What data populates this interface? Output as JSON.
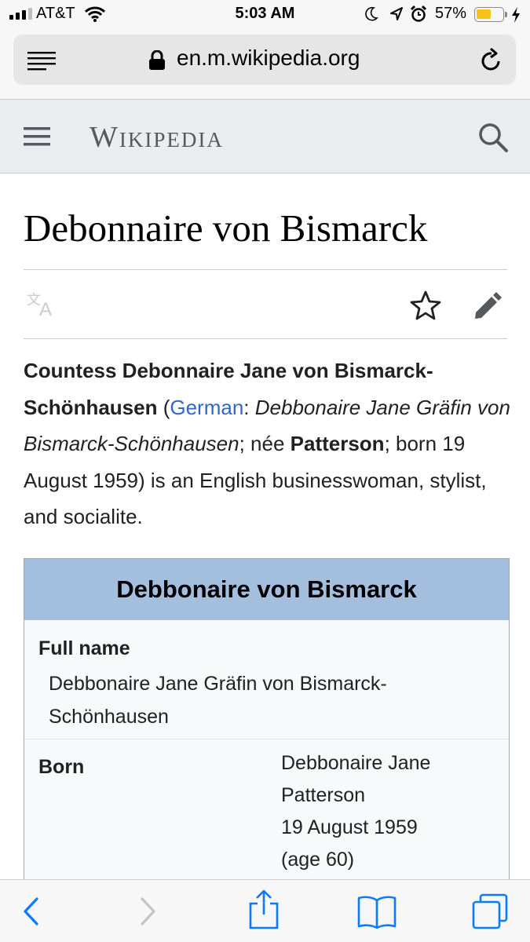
{
  "status_bar": {
    "carrier": "AT&T",
    "time": "5:03 AM",
    "battery_percent": "57%",
    "battery_level": 0.57,
    "icons": [
      "signal-icon",
      "wifi-icon",
      "moon-icon",
      "location-icon",
      "alarm-icon",
      "battery-icon",
      "charging-icon"
    ]
  },
  "address_bar": {
    "url": "en.m.wikipedia.org",
    "icons": [
      "reader-menu-icon",
      "lock-icon",
      "reload-icon"
    ]
  },
  "wiki_header": {
    "logo": "Wikipedia",
    "icons": [
      "hamburger-menu-icon",
      "search-icon"
    ]
  },
  "article": {
    "title": "Debonnaire von Bismarck",
    "action_icons": [
      "language-icon",
      "star-icon",
      "edit-pencil-icon"
    ],
    "intro": {
      "bold_name_1": "Countess Debonnaire Jane von Bismarck-",
      "bold_name_2": "Schönhausen",
      "paren_open": " (",
      "german_link": "German",
      "colon": ": ",
      "german_name": "Debbonaire Jane Gräfin von Bismarck-Schönhausen",
      "semi_nee": "; née ",
      "birth_name": "Patterson",
      "rest": "; born 19 August 1959) is an English businesswoman, stylist, and socialite."
    }
  },
  "infobox": {
    "title": "Debbonaire von Bismarck",
    "full_name_label": "Full name",
    "full_name_value": "Debbonaire Jane Gräfin von Bismarck-Schönhausen",
    "born_label": "Born",
    "born_lines": [
      "Debbonaire Jane",
      "Patterson",
      "19 August 1959",
      "(age 60)"
    ]
  },
  "toolbar": {
    "icons": [
      "back-icon",
      "forward-icon",
      "share-icon",
      "bookmarks-icon",
      "tabs-icon"
    ]
  },
  "colors": {
    "link": "#3366cc",
    "infobox_header": "#a3bfdd",
    "ios_blue": "#0a7aff",
    "battery": "#f7c31a"
  }
}
